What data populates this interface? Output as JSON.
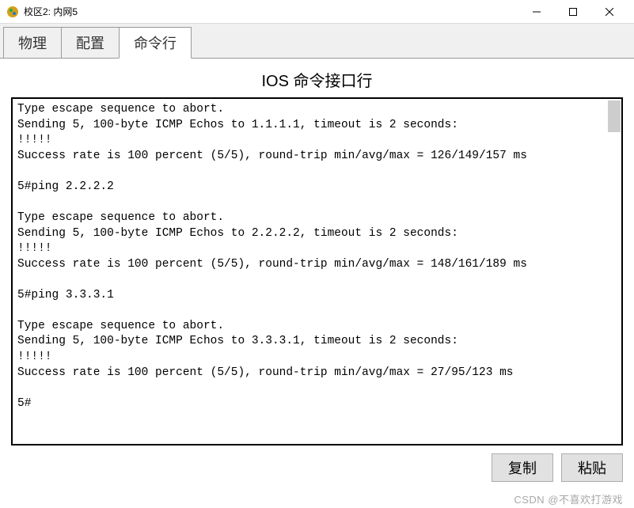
{
  "window": {
    "title": "校区2: 内网5"
  },
  "tabs": {
    "items": [
      {
        "label": "物理",
        "active": false
      },
      {
        "label": "配置",
        "active": false
      },
      {
        "label": "命令行",
        "active": true
      }
    ]
  },
  "panel": {
    "title": "IOS 命令接口行"
  },
  "terminal": {
    "content": "Type escape sequence to abort.\nSending 5, 100-byte ICMP Echos to 1.1.1.1, timeout is 2 seconds:\n!!!!!\nSuccess rate is 100 percent (5/5), round-trip min/avg/max = 126/149/157 ms\n\n5#ping 2.2.2.2\n\nType escape sequence to abort.\nSending 5, 100-byte ICMP Echos to 2.2.2.2, timeout is 2 seconds:\n!!!!!\nSuccess rate is 100 percent (5/5), round-trip min/avg/max = 148/161/189 ms\n\n5#ping 3.3.3.1\n\nType escape sequence to abort.\nSending 5, 100-byte ICMP Echos to 3.3.3.1, timeout is 2 seconds:\n!!!!!\nSuccess rate is 100 percent (5/5), round-trip min/avg/max = 27/95/123 ms\n\n5#"
  },
  "buttons": {
    "copy": "复制",
    "paste": "粘贴"
  },
  "watermark": "CSDN @不喜欢打游戏"
}
